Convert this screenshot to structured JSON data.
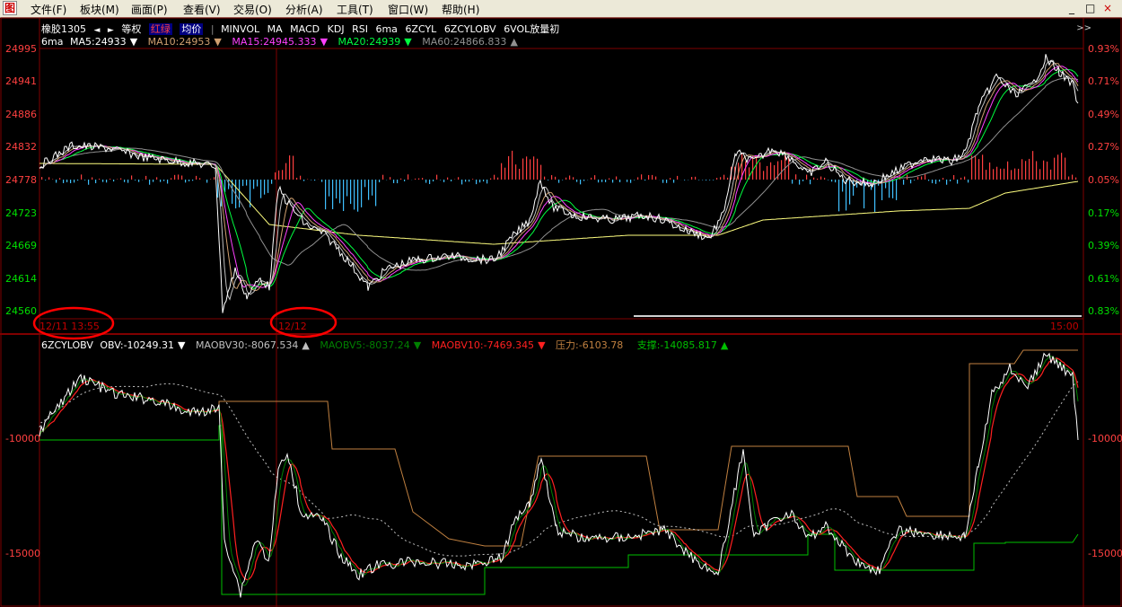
{
  "menu": {
    "items": [
      "文件(F)",
      "板块(M)",
      "画面(P)",
      "查看(V)",
      "交易(O)",
      "分析(A)",
      "工具(T)",
      "窗口(W)",
      "帮助(H)"
    ]
  },
  "window_controls": {
    "minimize": "_",
    "restore": "□",
    "close": "×"
  },
  "toolbar": {
    "symbol": "橡胶1305",
    "prev_arrow": "◄",
    "next_arrow": "►",
    "items": [
      "等权",
      "红绿",
      "均价",
      "MINVOL",
      "MA",
      "MACD",
      "KDJ",
      "RSI",
      "6ma",
      "6ZCYL",
      "6ZCYLOBV",
      "6VOL放量初"
    ],
    "right_button": ">>"
  },
  "price_panel": {
    "indicator_name": "6ma",
    "indicators": [
      {
        "label": "MA5:24933",
        "color": "#ffffff",
        "arrow": "▼"
      },
      {
        "label": "MA10:24953",
        "color": "#d0a070",
        "arrow": "▼"
      },
      {
        "label": "MA15:24945.333",
        "color": "#ff40ff",
        "arrow": "▼"
      },
      {
        "label": "MA20:24939",
        "color": "#00ff40",
        "arrow": "▼"
      },
      {
        "label": "MA60:24866.833",
        "color": "#909090",
        "arrow": "▲"
      }
    ],
    "y_ticks": [
      "24995",
      "24941",
      "24886",
      "24832",
      "24778",
      "24723",
      "24669",
      "24614",
      "24560"
    ],
    "y_tick_colors": [
      "#ff4040",
      "#ff4040",
      "#ff4040",
      "#ff4040",
      "#ff4040",
      "#00e000",
      "#00e000",
      "#00e000",
      "#00e000"
    ],
    "pct_ticks": [
      "0.93%",
      "0.71%",
      "0.49%",
      "0.27%",
      "0.05%",
      "0.17%",
      "0.39%",
      "0.61%",
      "0.83%"
    ],
    "pct_tick_colors": [
      "#ff4040",
      "#ff4040",
      "#ff4040",
      "#ff4040",
      "#ff4040",
      "#00e000",
      "#00e000",
      "#00e000",
      "#00e000"
    ],
    "date_labels": [
      "12/11 13:55",
      "12/12",
      "15:00"
    ]
  },
  "obv_panel": {
    "indicator_name": "6ZCYLOBV",
    "indicators": [
      {
        "label": "OBV:-10249.31",
        "color": "#ffffff",
        "arrow": "▼"
      },
      {
        "label": "MAOBV30:-8067.534",
        "color": "#c0c0c0",
        "arrow": "▲"
      },
      {
        "label": "MAOBV5:-8037.24",
        "color": "#008000",
        "arrow": "▼"
      },
      {
        "label": "MAOBV10:-7469.345",
        "color": "#ff2020",
        "arrow": "▼"
      },
      {
        "label": "压力:-6103.78",
        "color": "#c08040",
        "arrow": ""
      },
      {
        "label": "支撑:-14085.817",
        "color": "#00c000",
        "arrow": "▲"
      }
    ],
    "y_ticks": [
      "-10000",
      "-15000"
    ]
  },
  "chart_data": {
    "type": "line",
    "x": [
      "12/11 13:55",
      "12/12",
      "15:00"
    ],
    "series": [
      {
        "name": "MA5",
        "color": "#ffffff",
        "last": 24933
      },
      {
        "name": "MA10",
        "color": "#d0a070",
        "last": 24953
      },
      {
        "name": "MA15",
        "color": "#ff40ff",
        "last": 24945.333
      },
      {
        "name": "MA20",
        "color": "#00ff40",
        "last": 24939
      },
      {
        "name": "MA60",
        "color": "#909090",
        "last": 24866.833
      }
    ],
    "obv_series": [
      {
        "name": "OBV",
        "last": -10249.31
      },
      {
        "name": "MAOBV30",
        "last": -8067.534
      },
      {
        "name": "MAOBV5",
        "last": -8037.24
      },
      {
        "name": "MAOBV10",
        "last": -7469.345
      },
      {
        "name": "压力",
        "last": -6103.78
      },
      {
        "name": "支撑",
        "last": -14085.817
      }
    ],
    "ylim": [
      24560,
      24995
    ],
    "obv_ylim": [
      -17000,
      -6000
    ],
    "annotations": [
      "red ellipse around 12/11 13:55",
      "red ellipse around 12/12"
    ]
  },
  "colors": {
    "up": "#ff4040",
    "down": "#00e000",
    "grid": "#800000",
    "highlight": "#ff0000"
  }
}
